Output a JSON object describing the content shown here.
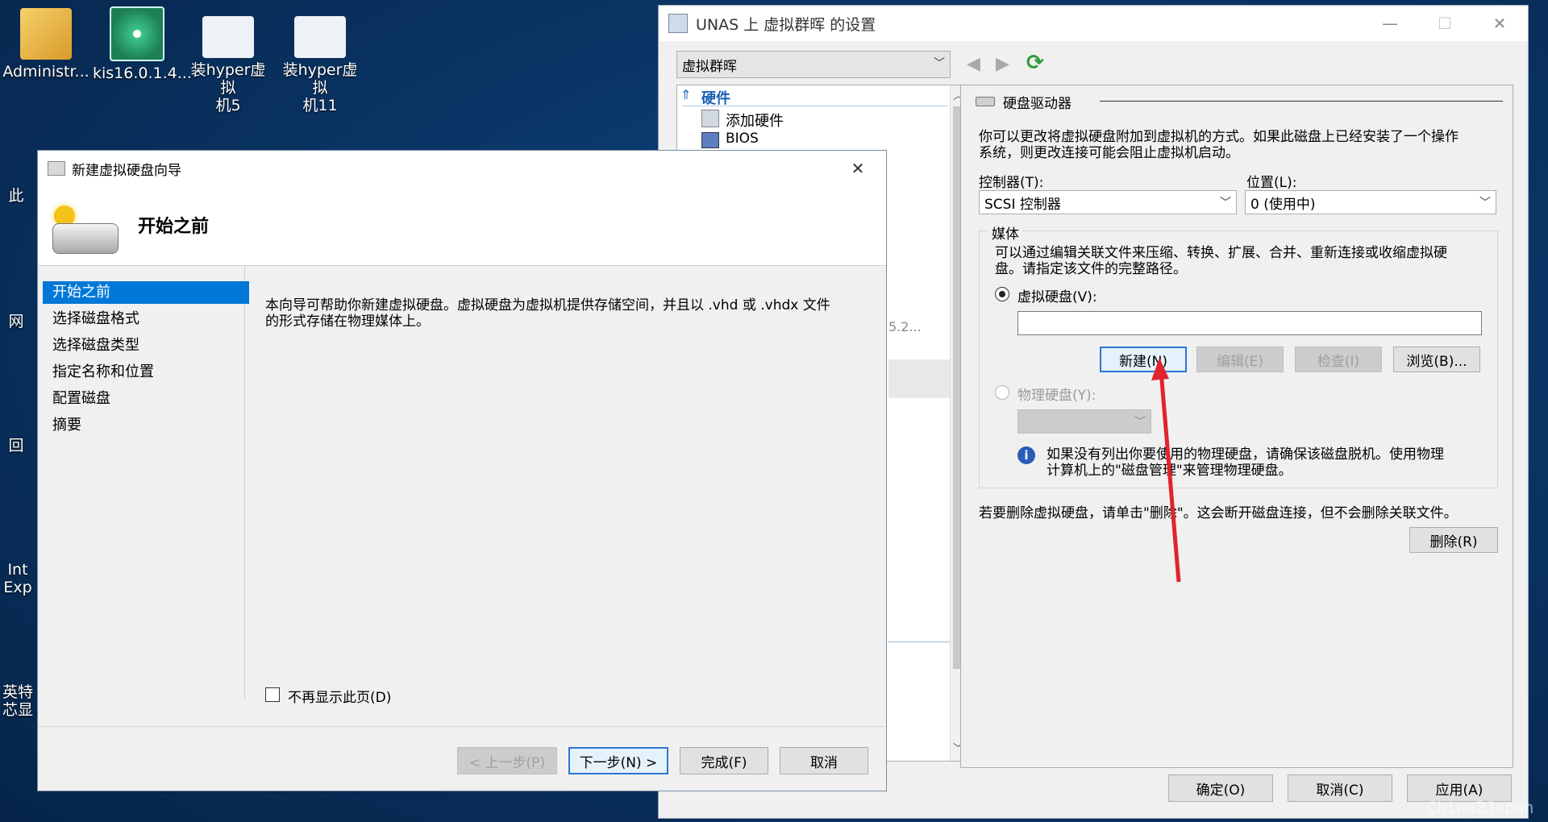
{
  "desktop": {
    "icons": [
      {
        "label": "Administr...",
        "color": "#e6b84a"
      },
      {
        "label": "kis16.0.1.4...",
        "color": "#2a9d6a"
      },
      {
        "label": "装hyper虚拟\n机5",
        "color": "#e8eef6"
      },
      {
        "label": "装hyper虚拟\n机11",
        "color": "#e8eef6"
      }
    ],
    "partial_labels": [
      "此",
      "网",
      "回",
      "Int\nExp",
      "英特\n芯显"
    ]
  },
  "settings_window": {
    "title": "UNAS 上 虚拟群晖 的设置",
    "vm_select": "虚拟群晖",
    "tree": {
      "section": "硬件",
      "items": [
        "添加硬件",
        "BIOS"
      ],
      "partial_text": "5.2..."
    },
    "panel": {
      "heading": "硬盘驱动器",
      "description": "你可以更改将虚拟硬盘附加到虚拟机的方式。如果此磁盘上已经安装了一个操作\n系统，则更改连接可能会阻止虚拟机启动。",
      "controller_label": "控制器(T):",
      "controller_value": "SCSI 控制器",
      "location_label": "位置(L):",
      "location_value": "0 (使用中)",
      "media_label": "媒体",
      "media_description": "可以通过编辑关联文件来压缩、转换、扩展、合并、重新连接或收缩虚拟硬\n盘。请指定该文件的完整路径。",
      "virtual_disk_label": "虚拟硬盘(V):",
      "virtual_disk_path": "",
      "btn_new": "新建(N)",
      "btn_edit": "编辑(E)",
      "btn_inspect": "检查(I)",
      "btn_browse": "浏览(B)...",
      "physical_disk_label": "物理硬盘(Y):",
      "info_text": "如果没有列出你要使用的物理硬盘，请确保该磁盘脱机。使用物理\n计算机上的\"磁盘管理\"来管理物理硬盘。",
      "remove_text": "若要删除虚拟硬盘，请单击\"删除\"。这会断开磁盘连接，但不会删除关联文件。",
      "btn_remove": "删除(R)"
    },
    "footer": {
      "ok": "确定(O)",
      "cancel": "取消(C)",
      "apply": "应用(A)"
    }
  },
  "wizard": {
    "title": "新建虚拟硬盘向导",
    "header": "开始之前",
    "steps": [
      "开始之前",
      "选择磁盘格式",
      "选择磁盘类型",
      "指定名称和位置",
      "配置磁盘",
      "摘要"
    ],
    "body": "本向导可帮助你新建虚拟硬盘。虚拟硬盘为虚拟机提供存储空间，并且以 .vhd 或 .vhdx 文件\n的形式存储在物理媒体上。",
    "dont_show": "不再显示此页(D)",
    "btn_prev": "< 上一步(P)",
    "btn_next": "下一步(N) >",
    "btn_finish": "完成(F)",
    "btn_cancel": "取消"
  },
  "watermark": "China2Japan",
  "colors": {
    "accent": "#2b76d3",
    "selection": "#0078d7",
    "arrow": "#e0232d"
  }
}
